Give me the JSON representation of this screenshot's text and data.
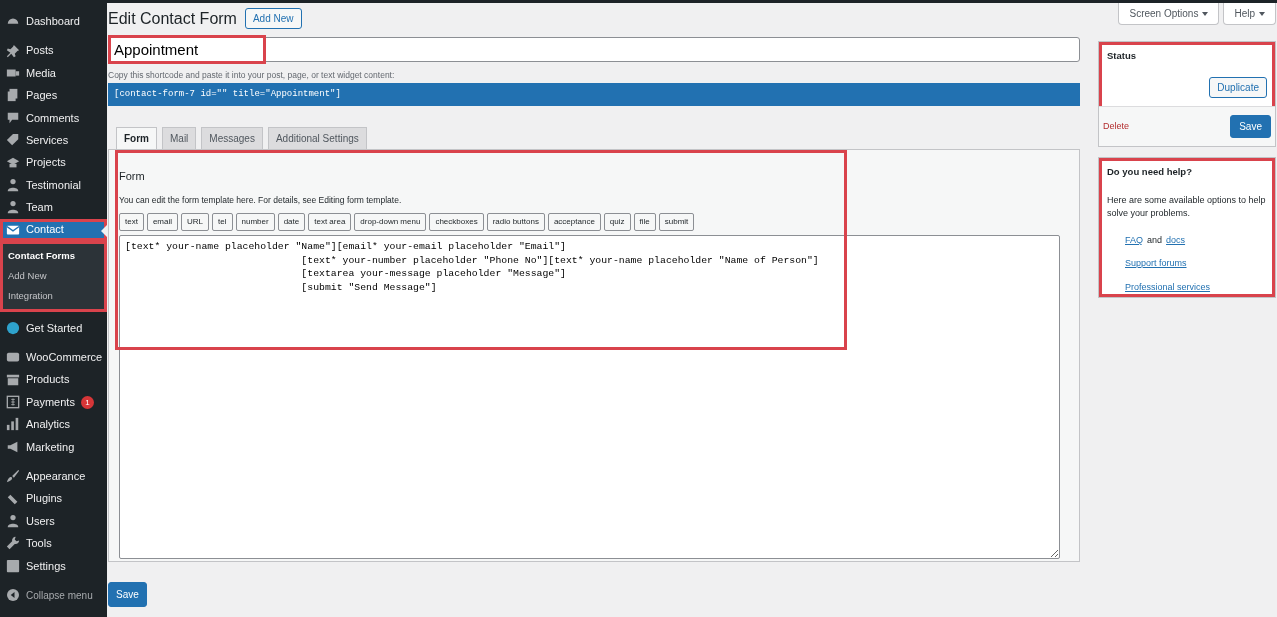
{
  "sidebar": {
    "sections": [
      {
        "items": [
          {
            "label": "Dashboard",
            "selected": false,
            "highlighted": false
          }
        ]
      },
      {
        "items": [
          {
            "label": "Posts",
            "selected": false,
            "highlighted": false
          },
          {
            "label": "Media",
            "selected": false,
            "highlighted": false
          },
          {
            "label": "Pages",
            "selected": false,
            "highlighted": false
          },
          {
            "label": "Comments",
            "selected": false,
            "highlighted": false
          },
          {
            "label": "Services",
            "selected": false,
            "highlighted": false
          },
          {
            "label": "Projects",
            "selected": false,
            "highlighted": false
          },
          {
            "label": "Testimonial",
            "selected": false,
            "highlighted": false
          },
          {
            "label": "Team",
            "selected": false,
            "highlighted": false
          },
          {
            "label": "Contact",
            "selected": true,
            "highlighted": true,
            "submenu_highlighted": true,
            "submenu": [
              {
                "label": "Contact Forms",
                "selected": true
              },
              {
                "label": "Add New",
                "selected": false
              },
              {
                "label": "Integration",
                "selected": false
              }
            ]
          },
          {
            "label": "Get Started",
            "selected": false,
            "highlighted": false
          }
        ]
      },
      {
        "items": [
          {
            "label": "WooCommerce",
            "selected": false,
            "highlighted": false
          },
          {
            "label": "Products",
            "selected": false,
            "highlighted": false
          },
          {
            "label": "Payments",
            "selected": false,
            "highlighted": false,
            "badge": "1"
          },
          {
            "label": "Analytics",
            "selected": false,
            "highlighted": false
          },
          {
            "label": "Marketing",
            "selected": false,
            "highlighted": false
          }
        ]
      },
      {
        "items": [
          {
            "label": "Appearance",
            "selected": false,
            "highlighted": false
          },
          {
            "label": "Plugins",
            "selected": false,
            "highlighted": false
          },
          {
            "label": "Users",
            "selected": false,
            "highlighted": false
          },
          {
            "label": "Tools",
            "selected": false,
            "highlighted": false
          },
          {
            "label": "Settings",
            "selected": false,
            "highlighted": false
          }
        ]
      }
    ],
    "collapse": "Collapse menu"
  },
  "header": {
    "title": "Edit Contact Form",
    "add_new": "Add New"
  },
  "screen_meta": {
    "screen_options": "Screen Options",
    "help": "Help"
  },
  "title_field": {
    "value": "Appointment",
    "highlighted": true
  },
  "shortcode_hint": "Copy this shortcode and paste it into your post, page, or text widget content:",
  "shortcode": "[contact-form-7 id=\"\" title=\"Appointment\"]",
  "tabs": [
    {
      "label": "Form",
      "selected": true
    },
    {
      "label": "Mail",
      "selected": false
    },
    {
      "label": "Messages",
      "selected": false
    },
    {
      "label": "Additional Settings",
      "selected": false
    }
  ],
  "form_panel": {
    "highlighted": true,
    "heading": "Form",
    "description": "You can edit the form template here. For details, see ",
    "link": "Editing form template",
    "description_end": ".",
    "tag_buttons": [
      "text",
      "email",
      "URL",
      "tel",
      "number",
      "date",
      "text area",
      "drop-down menu",
      "checkboxes",
      "radio buttons",
      "acceptance",
      "quiz",
      "file",
      "submit"
    ],
    "template": "[text* your-name placeholder \"Name\"][email* your-email placeholder \"Email\"]\n                              [text* your-number placeholder \"Phone No\"][text* your-name placeholder \"Name of Person\"]\n                              [textarea your-message placeholder \"Message\"]\n                              [submit \"Send Message\"]"
  },
  "save": "Save",
  "status_box": {
    "highlighted": true,
    "title": "Status",
    "duplicate": "Duplicate",
    "delete": "Delete",
    "save": "Save"
  },
  "help_box": {
    "highlighted": true,
    "title": "Do you need help?",
    "text": "Here are some available options to help solve your problems.",
    "lines": [
      {
        "parts": [
          {
            "text": "FAQ",
            "link": true
          },
          {
            "text": "and",
            "link": false
          },
          {
            "text": "docs",
            "link": true
          }
        ]
      },
      {
        "parts": [
          {
            "text": "Support forums",
            "link": true
          }
        ]
      },
      {
        "parts": [
          {
            "text": "Professional services",
            "link": true
          }
        ]
      }
    ]
  }
}
